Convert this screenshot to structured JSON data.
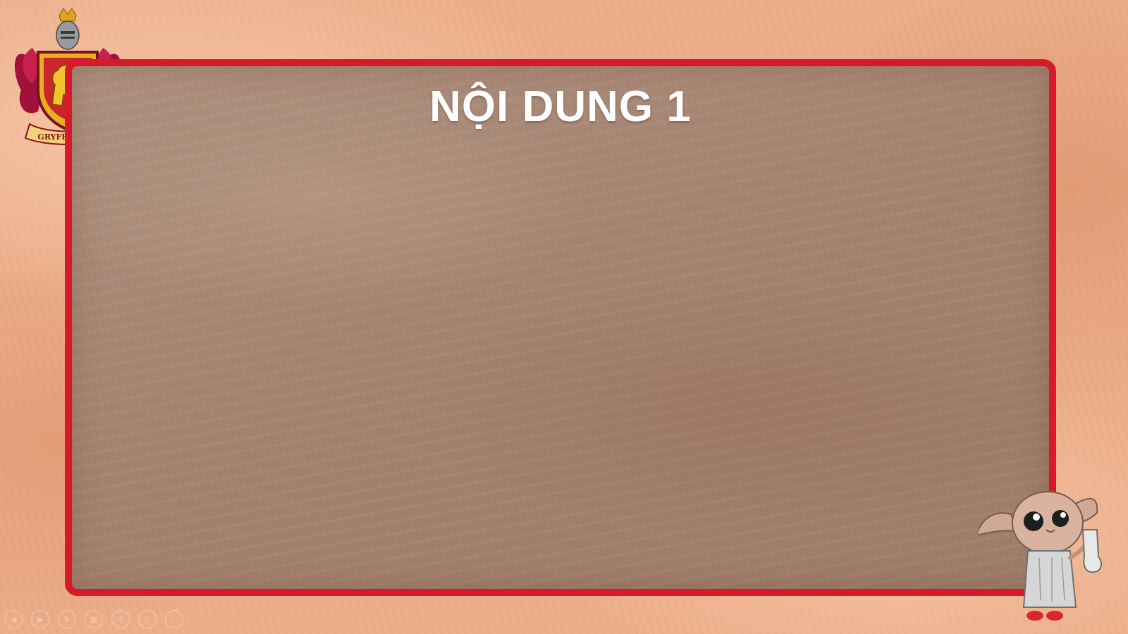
{
  "slide": {
    "title": "NỘI DUNG 1"
  },
  "crest": {
    "banner_text": "GRYFFINDOR"
  },
  "colors": {
    "frame_border": "#d51a2b",
    "background": "#ecae8a",
    "panel": "#a4826f",
    "title_text": "#ffffff"
  },
  "toolbar": {
    "buttons": [
      {
        "name": "previous-slide",
        "icon": "◀"
      },
      {
        "name": "next-slide",
        "icon": "▶"
      },
      {
        "name": "pen",
        "icon": "✎"
      },
      {
        "name": "slides-grid",
        "icon": "▦"
      },
      {
        "name": "zoom",
        "icon": "⚲"
      },
      {
        "name": "subtitles",
        "icon": "◌"
      },
      {
        "name": "more-options",
        "icon": "⋯"
      }
    ]
  }
}
